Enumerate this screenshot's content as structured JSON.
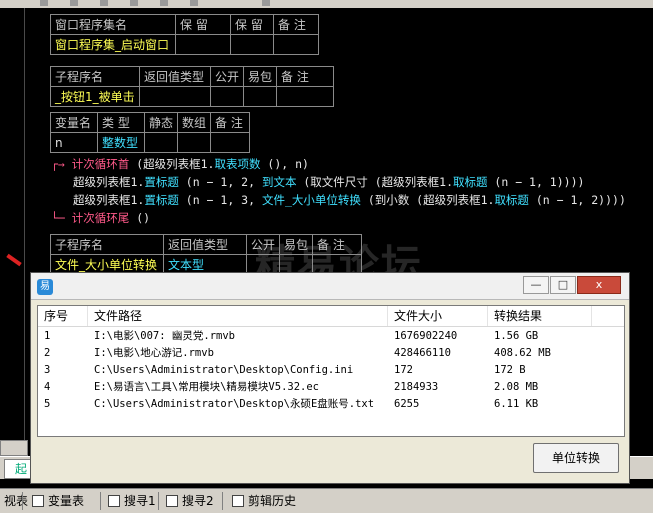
{
  "program_set_table": {
    "headers": [
      "窗口程序集名",
      "保 留",
      "保 留",
      "备 注"
    ],
    "values": [
      "窗口程序集_启动窗口",
      "",
      "",
      ""
    ]
  },
  "sub1_table": {
    "headers": [
      "子程序名",
      "返回值类型",
      "公开",
      "易包",
      "备 注"
    ],
    "values": [
      "_按钮1_被单击",
      "",
      "",
      "",
      ""
    ]
  },
  "var_table": {
    "headers": [
      "变量名",
      "类 型",
      "静态",
      "数组",
      "备 注"
    ],
    "values": [
      "n",
      "整数型",
      "",
      "",
      ""
    ]
  },
  "code": {
    "line1_kw": "计次循环首",
    "line1_a": " (超级列表框1.",
    "line1_fn": "取表项数",
    "line1_b": " (), n)",
    "line2_a": "超级列表框1.",
    "line2_fn": "置标题",
    "line2_b": " (n − 1, 2, ",
    "line2_fn2": "到文本",
    "line2_c": " (取文件尺寸 (超级列表框1.",
    "line2_fn3": "取标题",
    "line2_d": " (n − 1, 1))))",
    "line3_a": "超级列表框1.",
    "line3_fn": "置标题",
    "line3_b": " (n − 1, 3, ",
    "line3_fn2": "文件_大小单位转换",
    "line3_c": " (到小数 (超级列表框1.",
    "line3_fn3": "取标题",
    "line3_d": " (n − 1, 2))))",
    "line4_kw": "计次循环尾",
    "line4_b": " ()"
  },
  "sub2_table": {
    "headers": [
      "子程序名",
      "返回值类型",
      "公开",
      "易包",
      "备 注"
    ],
    "values": [
      "文件_大小单位转换",
      "文本型"
    ]
  },
  "watermark": "精易论坛",
  "dialog": {
    "app_icon": "易",
    "minimize": "—",
    "maximize": "□",
    "close": "x",
    "columns": [
      "序号",
      "文件路径",
      "文件大小",
      "转换结果"
    ],
    "rows": [
      [
        "1",
        "I:\\电影\\007: 幽灵党.rmvb",
        "1676902240",
        "1.56 GB"
      ],
      [
        "2",
        "I:\\电影\\地心游记.rmvb",
        "428466110",
        "408.62 MB"
      ],
      [
        "3",
        "C:\\Users\\Administrator\\Desktop\\Config.ini",
        "172",
        "172 B"
      ],
      [
        "4",
        "E:\\易语言\\工具\\常用模块\\精易模块V5.32.ec",
        "2184933",
        "2.08 MB"
      ],
      [
        "5",
        "C:\\Users\\Administrator\\Desktop\\永硕E盘账号.txt",
        "6255",
        "6.11 KB"
      ]
    ],
    "button_label": "单位转换"
  },
  "bottom_tab": "起",
  "status": {
    "items": [
      "视表",
      "变量表",
      "搜寻1",
      "搜寻2",
      "剪辑历史"
    ]
  },
  "colors": {
    "editor_bg": "#000000",
    "keyword": "#ff5a8a",
    "function": "#40e0ff",
    "name_yellow": "#ffff55"
  }
}
